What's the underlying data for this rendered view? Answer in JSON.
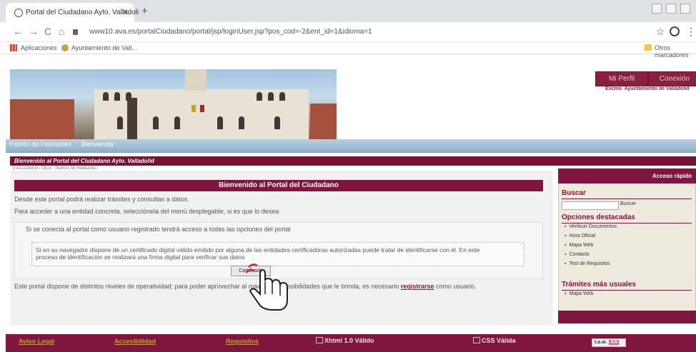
{
  "browser": {
    "tab_title": "Portal del Ciudadano Ayto. Valladoli",
    "tab_close": "✕",
    "new_tab": "+",
    "back": "←",
    "forward": "→",
    "reload": "C",
    "home": "⌂",
    "url": "www10.ava.es/portalCiudadano/portal/jsp/loginUser.jsp?pos_cod=-2&ent_id=1&idioma=1",
    "star": "☆",
    "menu": "⋮",
    "bookmarks": {
      "apps": "Aplicaciones",
      "ayto": "Ayuntamiento de Vall...",
      "other": "Otros marcadores"
    }
  },
  "header": {
    "mi_perfil": "Mi Perfil",
    "conexion": "Conexión",
    "ayto_caption": "Excmo. Ayuntamiento de Valladolid"
  },
  "nav": {
    "padron": "Padrón de Habitantes",
    "bienvenida": "Bienvenida"
  },
  "welcome_bar": "Bienvenido al Portal del Ciudadano Ayto. Valladolid",
  "breadcrumb": "Está usted en: Inicio · Padrón de Habitantes",
  "main": {
    "heading": "Bienvenido al Portal del Ciudadano",
    "p1": "Desde este portal podrá realizar trámites y consultas a datos.",
    "p2": "Para acceder a una entidad concreta, selecciónela del menú desplegable, si es que lo desea",
    "p3": "Si se conecta al portal como usuario registrado tendrá acceso a todas las opciones del portal",
    "p4a": "Si en su navegador dispone de un certificado digital válido emitido por alguna de las entidades certificadoras autorizadas puede tratar de identificarse con él. En este",
    "p4b": "proceso de identificación se realizará una firma digital para verificar sus datos",
    "cert_button": "Certificado",
    "p5_before": "Este portal dispone de distintos niveles de operatividad; para poder aprovechar al máximo las posibilidades que le brinda, es necesario",
    "p5_link": "registrarse",
    "p5_after": "como usuario."
  },
  "sidebar": {
    "header": "Acceso rápido",
    "buscar_title": "Buscar",
    "buscar_button": "Buscar",
    "destacadas_title": "Opciones destacadas",
    "destacadas": [
      "Verificar Documentos",
      "Hora Oficial",
      "Mapa Web",
      "Contacto",
      "Test de Requisitos"
    ],
    "tramites_title": "Trámites más usuales",
    "tramites": [
      "Mapa Web"
    ]
  },
  "footer": {
    "aviso": "Aviso Legal",
    "accesibilidad": "Accesibilidad",
    "requisitos": "Requisitos",
    "xhtml": "Xhtml 1.0 Válido",
    "css": "CSS Válida",
    "taw": "t.a.w.",
    "taw_aa": "AA"
  }
}
